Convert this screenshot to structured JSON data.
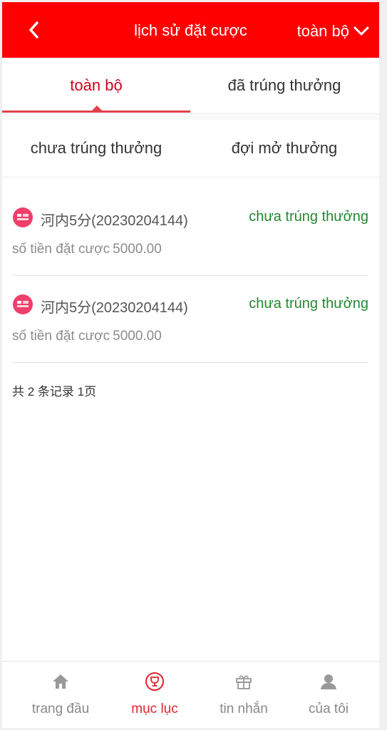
{
  "header": {
    "title": "lịch sử đặt cược",
    "filter_label": "toàn bộ"
  },
  "tabs": [
    {
      "label": "toàn bộ",
      "active": true
    },
    {
      "label": "đã trúng thưởng",
      "active": false
    },
    {
      "label": "chưa trúng thưởng",
      "active": false
    },
    {
      "label": "đợi mở thưởng",
      "active": false
    }
  ],
  "records": [
    {
      "icon": "lottery-icon",
      "game": "河内5分",
      "issue": "(20230204144)",
      "status": "chưa trúng thưởng",
      "amount_label": "số tiền đặt cược",
      "amount": "5000.00"
    },
    {
      "icon": "lottery-icon",
      "game": "河内5分",
      "issue": "(20230204144)",
      "status": "chưa trúng thưởng",
      "amount_label": "số tiền đặt cược",
      "amount": "5000.00"
    }
  ],
  "summary": "共 2 条记录 1页",
  "bottom_nav": [
    {
      "label": "trang đầu",
      "icon": "home-icon",
      "active": false
    },
    {
      "label": "mục lục",
      "icon": "trophy-icon",
      "active": true
    },
    {
      "label": "tin nhắn",
      "icon": "gift-icon",
      "active": false
    },
    {
      "label": "của tôi",
      "icon": "user-icon",
      "active": false
    }
  ],
  "colors": {
    "header_bg": "#ff0000",
    "accent": "#e0242d",
    "status_green": "#1f8a2e"
  }
}
